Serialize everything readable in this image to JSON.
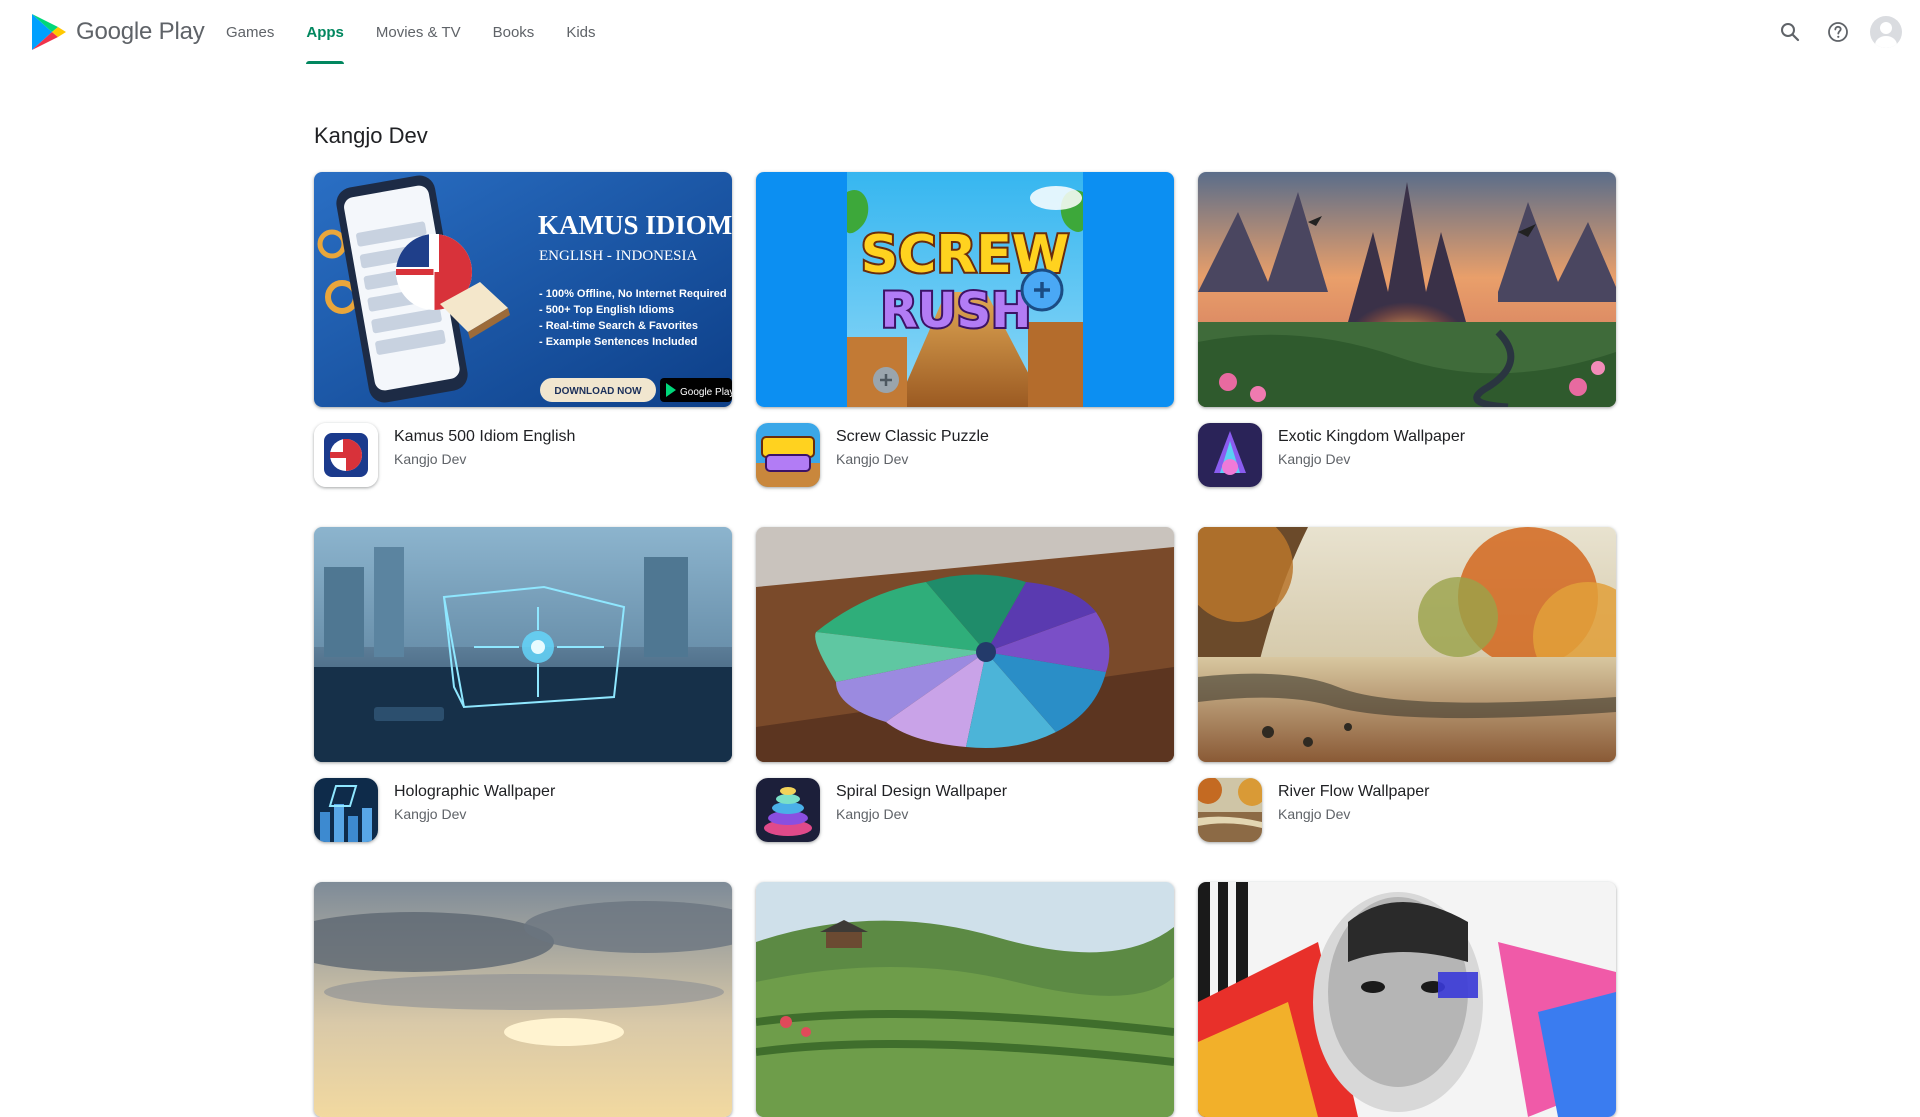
{
  "header": {
    "brand": "Google Play",
    "nav": [
      {
        "label": "Games",
        "active": false
      },
      {
        "label": "Apps",
        "active": true
      },
      {
        "label": "Movies & TV",
        "active": false
      },
      {
        "label": "Books",
        "active": false
      },
      {
        "label": "Kids",
        "active": false
      }
    ],
    "icons": {
      "search": "search-icon",
      "help": "help-icon",
      "account": "account-avatar"
    },
    "accent_color": "#01875f"
  },
  "developer": {
    "name": "Kangjo Dev"
  },
  "apps": [
    {
      "name": "Kamus 500 Idiom English",
      "developer": "Kangjo Dev",
      "banner": {
        "title": "KAMUS IDIOM",
        "subtitle": "ENGLISH - INDONESIA",
        "bullets": [
          "- 100% Offline, No Internet Required",
          "- 500+ Top English Idioms",
          "- Real-time Search & Favorites",
          "- Example Sentences Included"
        ],
        "cta": "DOWNLOAD NOW",
        "badge": "Google Play"
      }
    },
    {
      "name": "Screw Classic Puzzle",
      "developer": "Kangjo Dev",
      "banner": {
        "logo_line1": "SCREW",
        "logo_line2": "RUSH"
      }
    },
    {
      "name": "Exotic Kingdom Wallpaper",
      "developer": "Kangjo Dev"
    },
    {
      "name": "Holographic Wallpaper",
      "developer": "Kangjo Dev"
    },
    {
      "name": "Spiral Design Wallpaper",
      "developer": "Kangjo Dev"
    },
    {
      "name": "River Flow Wallpaper",
      "developer": "Kangjo Dev"
    }
  ]
}
